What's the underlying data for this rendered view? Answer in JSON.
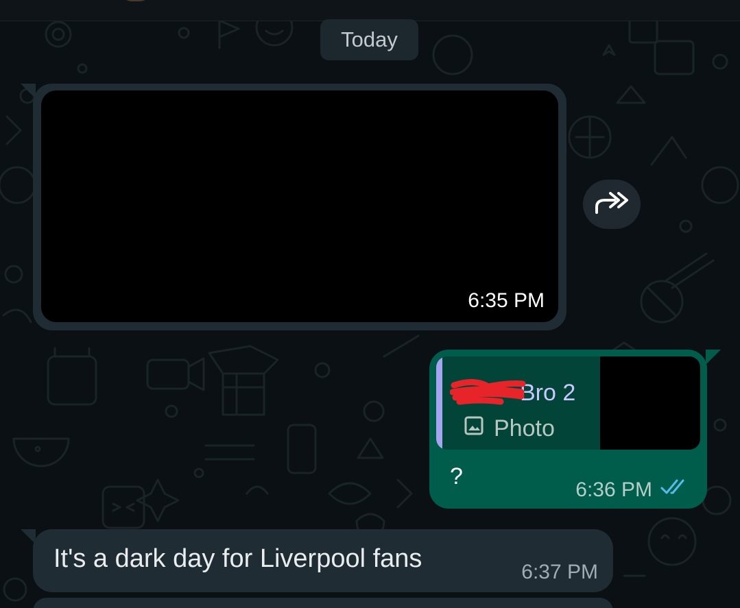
{
  "date_separator": "Today",
  "messages": [
    {
      "type": "image",
      "direction": "incoming",
      "time": "6:35 PM"
    },
    {
      "type": "reply",
      "direction": "outgoing",
      "quoted": {
        "author": "Bro 2",
        "media_label": "Photo"
      },
      "text": "?",
      "time": "6:36 PM",
      "status": "read"
    },
    {
      "type": "text",
      "direction": "incoming",
      "text": "It's a dark day for Liverpool fans",
      "time": "6:37 PM"
    }
  ],
  "icons": {
    "forward": "forward-icon",
    "photo": "image-icon",
    "read_receipt": "double-check-icon"
  },
  "colors": {
    "background": "#0b1014",
    "incoming_bubble": "#1f2c33",
    "outgoing_bubble": "#005c4b",
    "quote_bar": "#a5a5f0",
    "read_ticks": "#53bdeb"
  }
}
